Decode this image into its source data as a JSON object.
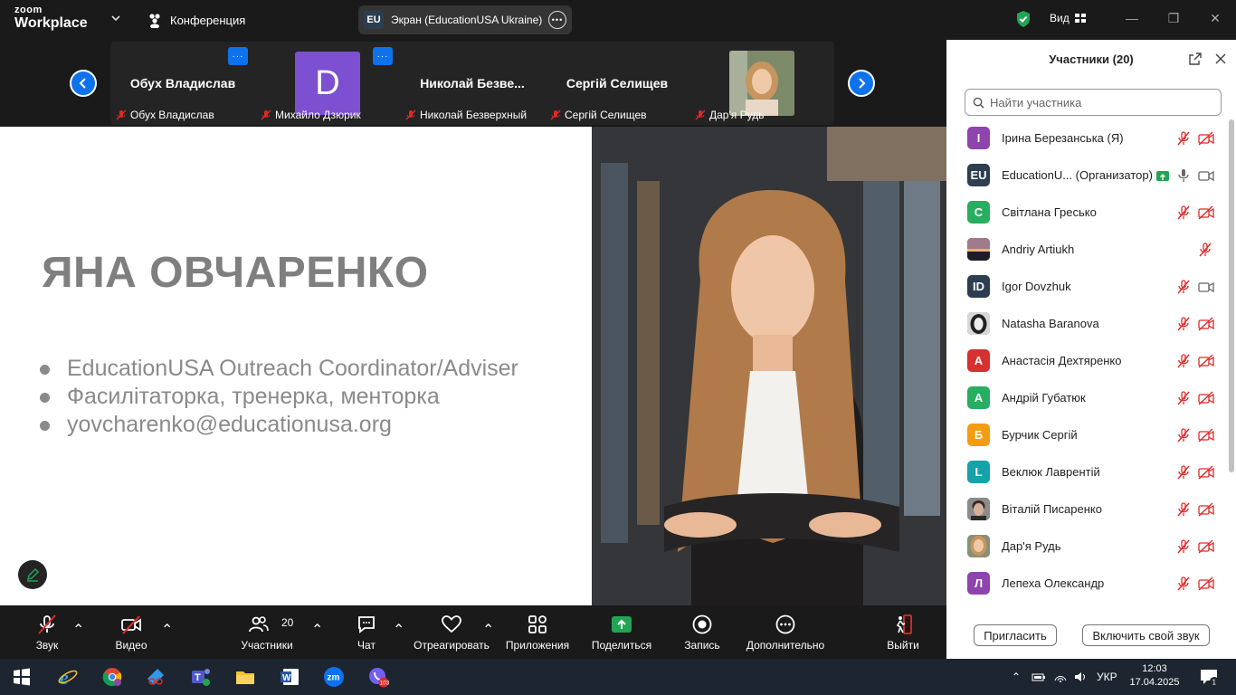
{
  "app": {
    "logo_line1": "zoom",
    "logo_line2": "Workplace",
    "meeting_label": "Конференция",
    "screen_share_badge": "EU",
    "screen_share_label": "Экран (EducationUSA Ukraine)",
    "view_label": "Вид"
  },
  "thumbnails": [
    {
      "big_name": "Обух Владислав",
      "caption": "Обух Владислав"
    },
    {
      "avatar_letter": "D",
      "caption": "Михайло Дзюрик"
    },
    {
      "big_name": "Николай  Безве...",
      "caption": "Николай Безверхный"
    },
    {
      "big_name": "Сергій Селищев",
      "caption": "Сергій Селищев"
    },
    {
      "caption": "Дар'я Рудь"
    }
  ],
  "slide": {
    "title": "ЯНА ОВЧАРЕНКО",
    "bullets": [
      "EducationUSA Outreach Coordinator/Adviser",
      "Фасилітаторка, тренерка, менторка",
      "yovcharenko@educationusa.org"
    ]
  },
  "toolbar": {
    "audio": "Звук",
    "video": "Видео",
    "participants": "Участники",
    "participants_count": "20",
    "chat": "Чат",
    "react": "Отреагировать",
    "apps": "Приложения",
    "share": "Поделиться",
    "record": "Запись",
    "more": "Дополнительно",
    "leave": "Выйти"
  },
  "panel": {
    "title": "Участники (20)",
    "search_placeholder": "Найти участника",
    "invite": "Пригласить",
    "unmute_self": "Включить свой звук",
    "participants": [
      {
        "initial": "І",
        "color": "#8e44ad",
        "name": "Ірина Березанська (Я)",
        "mic": "muted",
        "cam": "off"
      },
      {
        "initial": "EU",
        "color": "#2c3e50",
        "name": "EducationU...  (Организатор)",
        "mic": "on",
        "cam": "on",
        "sharing": true
      },
      {
        "initial": "С",
        "color": "#27ae60",
        "name": " Світлана Гресько",
        "mic": "muted",
        "cam": "off"
      },
      {
        "initial": "",
        "color": "#555555",
        "name": "Andriy Artiukh",
        "mic": "muted",
        "cam": "none",
        "photo": "sunset"
      },
      {
        "initial": "ID",
        "color": "#2c3e50",
        "name": "Igor Dovzhuk",
        "mic": "muted",
        "cam": "on"
      },
      {
        "initial": "",
        "color": "#333333",
        "name": "Natasha Baranova",
        "mic": "muted",
        "cam": "off",
        "photo": "face-dark"
      },
      {
        "initial": "А",
        "color": "#d63031",
        "name": "Анастасія Дехтяренко",
        "mic": "muted",
        "cam": "off"
      },
      {
        "initial": "А",
        "color": "#27ae60",
        "name": "Андрій Губатюк",
        "mic": "muted",
        "cam": "off"
      },
      {
        "initial": "Б",
        "color": "#f39c12",
        "name": "Бурчик Сергій",
        "mic": "muted",
        "cam": "off"
      },
      {
        "initial": "L",
        "color": "#16a2a8",
        "name": "Веклюк Лаврентій",
        "mic": "muted",
        "cam": "off"
      },
      {
        "initial": "",
        "color": "#6d5a4a",
        "name": "Віталій Писаренко",
        "mic": "muted",
        "cam": "off",
        "photo": "face-man"
      },
      {
        "initial": "",
        "color": "#c9a27a",
        "name": "Дар'я Рудь",
        "mic": "muted",
        "cam": "off",
        "photo": "face-woman"
      },
      {
        "initial": "Л",
        "color": "#8e44ad",
        "name": "Лепеха Олександр",
        "mic": "muted",
        "cam": "off"
      }
    ]
  },
  "taskbar": {
    "language": "УКР",
    "time": "12:03",
    "date": "17.04.2025",
    "viber_badge": "103",
    "notification_count": "1"
  },
  "colors": {
    "accent_blue": "#0e72ed",
    "muted_red": "#e02828",
    "share_green": "#23a455"
  }
}
